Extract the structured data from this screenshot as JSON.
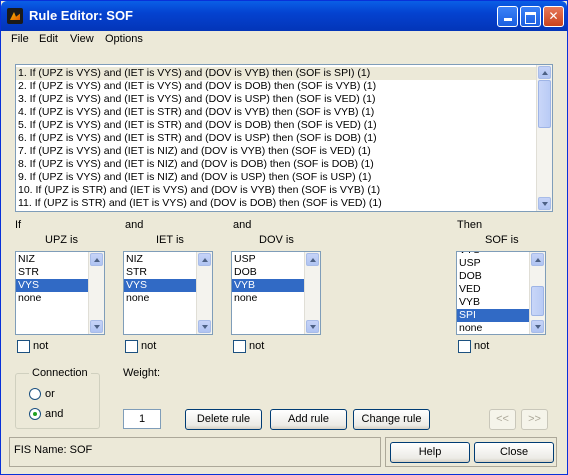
{
  "window": {
    "title": "Rule Editor: SOF"
  },
  "menu": [
    "File",
    "Edit",
    "View",
    "Options"
  ],
  "rules": [
    "1. If (UPZ is VYS) and (IET is VYS) and (DOV is VYB) then (SOF is SPI) (1)",
    "2. If (UPZ is VYS) and (IET is VYS) and (DOV is DOB) then (SOF is VYB) (1)",
    "3. If (UPZ is VYS) and (IET is VYS) and (DOV is USP) then (SOF is VED) (1)",
    "4. If (UPZ is VYS) and (IET is STR) and (DOV is VYB) then (SOF is VYB) (1)",
    "5. If (UPZ is VYS) and (IET is STR) and (DOV is DOB) then (SOF is VED) (1)",
    "6. If (UPZ is VYS) and (IET is STR) and (DOV is USP) then (SOF is DOB) (1)",
    "7. If (UPZ is VYS) and (IET is NIZ) and (DOV is VYB) then (SOF is VED) (1)",
    "8. If (UPZ is VYS) and (IET is NIZ) and (DOV is DOB) then (SOF is DOB) (1)",
    "9. If (UPZ is VYS) and (IET is NIZ) and (DOV is USP) then (SOF is USP) (1)",
    "10. If (UPZ is STR) and (IET is VYS) and (DOV is VYB) then (SOF is VYB) (1)",
    "11. If (UPZ is STR) and (IET is VYS) and (DOV is DOB) then (SOF is VED) (1)"
  ],
  "selected_rule_index": 0,
  "inputs": [
    {
      "conj": "If",
      "name": "UPZ is",
      "options": [
        "NIZ",
        "STR",
        "VYS",
        "none"
      ],
      "selected": "VYS",
      "not_label": "not",
      "not_checked": false
    },
    {
      "conj": "and",
      "name": "IET is",
      "options": [
        "NIZ",
        "STR",
        "VYS",
        "none"
      ],
      "selected": "VYS",
      "not_label": "not",
      "not_checked": false
    },
    {
      "conj": "and",
      "name": "DOV is",
      "options": [
        "USP",
        "DOB",
        "VYB",
        "none"
      ],
      "selected": "VYB",
      "not_label": "not",
      "not_checked": false
    }
  ],
  "output": {
    "conj": "Then",
    "name": "SOF is",
    "options": [
      "USP",
      "DOB",
      "VED",
      "VYB",
      "SPI",
      "none"
    ],
    "selected": "SPI",
    "not_label": "not",
    "not_checked": false
  },
  "connection": {
    "title": "Connection",
    "options": [
      "or",
      "and"
    ],
    "selected": "and"
  },
  "weight": {
    "label": "Weight:",
    "value": "1"
  },
  "buttons": {
    "delete": "Delete rule",
    "add": "Add rule",
    "change": "Change rule",
    "prev": "<<",
    "next": ">>"
  },
  "status": {
    "fis_name": "FIS Name: SOF"
  },
  "footer": {
    "help": "Help",
    "close": "Close"
  }
}
